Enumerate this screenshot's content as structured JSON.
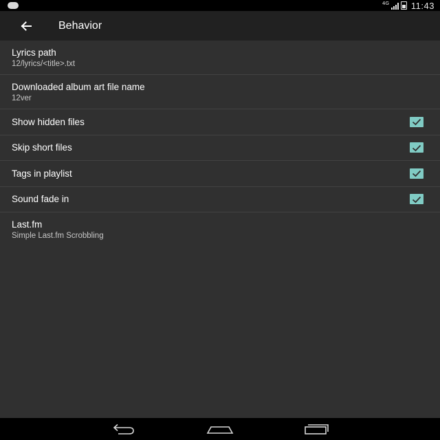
{
  "status_bar": {
    "network": "4G",
    "time": "11:43",
    "icons": [
      "notification-dot-icon",
      "signal-icon",
      "battery-icon"
    ]
  },
  "app_bar": {
    "title": "Behavior",
    "back_icon": "arrow-back-icon"
  },
  "settings": [
    {
      "title": "Lyrics path",
      "summary": "12/lyrics/<title>.txt"
    },
    {
      "title": "Downloaded album art file name",
      "summary": "12ver"
    },
    {
      "title": "Show hidden files",
      "checked": true
    },
    {
      "title": "Skip short files",
      "checked": true
    },
    {
      "title": "Tags in playlist",
      "checked": true
    },
    {
      "title": "Sound fade in",
      "checked": true
    },
    {
      "title": "Last.fm",
      "summary": "Simple Last.fm Scrobbling"
    }
  ],
  "navigation_bar": {
    "buttons": [
      "back-icon",
      "home-icon",
      "recents-icon"
    ]
  },
  "colors": {
    "background": "#303030",
    "app_bar": "#212121",
    "checkbox_accent": "#80cbc4",
    "divider": "#424242"
  }
}
